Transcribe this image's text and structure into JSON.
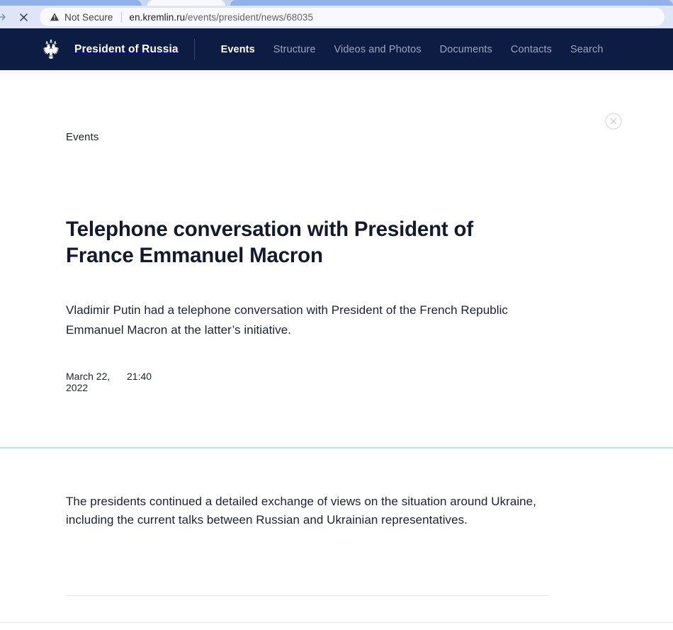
{
  "browser": {
    "forward_icon": "forward-arrow-icon",
    "stop_icon": "close-x-icon",
    "security_icon": "warning-triangle-icon",
    "security_label": "Not Secure",
    "url_host": "en.kremlin.ru",
    "url_path": "/events/president/news/68035",
    "url_full": "en.kremlin.ru/events/president/news/68035"
  },
  "header": {
    "logo_icon": "russian-coat-of-arms-eagle-icon",
    "brand": "President of Russia",
    "nav": [
      {
        "label": "Events",
        "active": true
      },
      {
        "label": "Structure",
        "active": false
      },
      {
        "label": "Videos and Photos",
        "active": false
      },
      {
        "label": "Documents",
        "active": false
      },
      {
        "label": "Contacts",
        "active": false
      },
      {
        "label": "Search",
        "active": false
      }
    ]
  },
  "article": {
    "close_icon": "circled-close-icon",
    "breadcrumb": "Events",
    "title": "Telephone conversation with President of France Emmanuel Macron",
    "lead": "Vladimir Putin had a telephone conversation with President of the French Republic Emmanuel Macron at the latter’s initiative.",
    "date": "March 22, 2022",
    "time": "21:40",
    "body": "The presidents continued a detailed exchange of views on the situation around Ukraine, including the current talks between Russian and Ukrainian representatives."
  },
  "colors": {
    "header_navy": "#0d1c43",
    "divider_mint": "#b6e4db",
    "chrome_blue": "#dee5f6",
    "text_dark": "#1b2135"
  }
}
